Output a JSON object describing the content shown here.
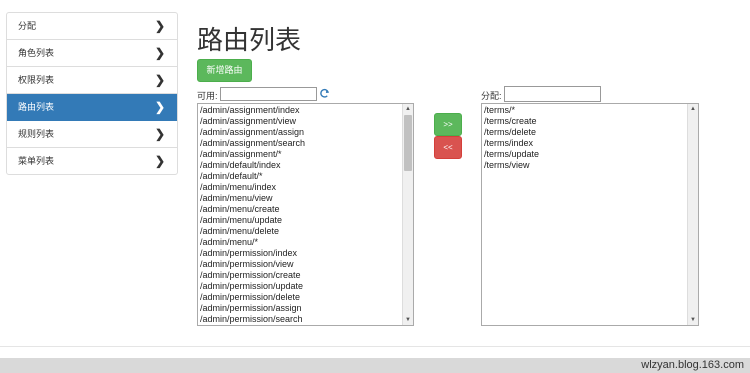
{
  "sidebar": {
    "items": [
      {
        "label": "分配",
        "active": false
      },
      {
        "label": "角色列表",
        "active": false
      },
      {
        "label": "权限列表",
        "active": false
      },
      {
        "label": "路由列表",
        "active": true
      },
      {
        "label": "规则列表",
        "active": false
      },
      {
        "label": "菜单列表",
        "active": false
      }
    ]
  },
  "page": {
    "title": "路由列表",
    "add_button": "新增路由"
  },
  "available": {
    "label": "可用:",
    "search_value": "",
    "items": [
      "/admin/assignment/index",
      "/admin/assignment/view",
      "/admin/assignment/assign",
      "/admin/assignment/search",
      "/admin/assignment/*",
      "/admin/default/index",
      "/admin/default/*",
      "/admin/menu/index",
      "/admin/menu/view",
      "/admin/menu/create",
      "/admin/menu/update",
      "/admin/menu/delete",
      "/admin/menu/*",
      "/admin/permission/index",
      "/admin/permission/view",
      "/admin/permission/create",
      "/admin/permission/update",
      "/admin/permission/delete",
      "/admin/permission/assign",
      "/admin/permission/search"
    ]
  },
  "assigned": {
    "label": "分配:",
    "search_value": "",
    "items": [
      "/terms/*",
      "/terms/create",
      "/terms/delete",
      "/terms/index",
      "/terms/update",
      "/terms/view"
    ]
  },
  "buttons": {
    "assign": ">>",
    "remove": "<<"
  },
  "watermark": "wlzyan.blog.163.com",
  "colors": {
    "primary": "#337ab7",
    "success": "#5cb85c",
    "danger": "#d9534f"
  }
}
